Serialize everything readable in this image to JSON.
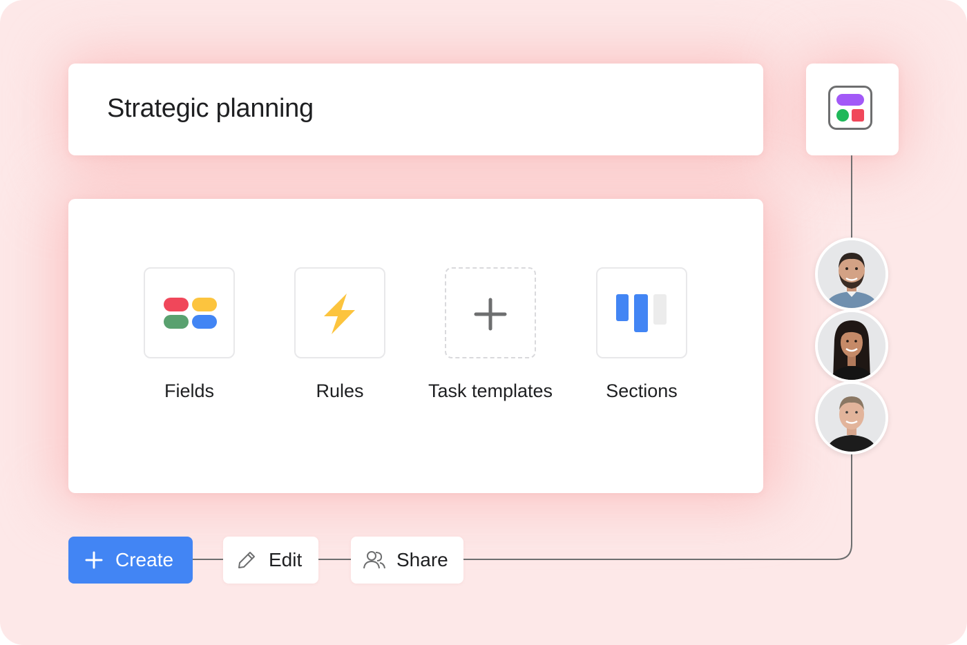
{
  "project": {
    "title": "Strategic planning",
    "logo_icon": "project-grid-icon"
  },
  "features": [
    {
      "label": "Fields",
      "icon": "fields-icon"
    },
    {
      "label": "Rules",
      "icon": "lightning-icon"
    },
    {
      "label": "Task templates",
      "icon": "plus-icon"
    },
    {
      "label": "Sections",
      "icon": "sections-icon"
    }
  ],
  "members": [
    {
      "icon": "avatar-man-beard"
    },
    {
      "icon": "avatar-woman-dark-hair"
    },
    {
      "icon": "avatar-man-short-hair"
    }
  ],
  "actions": {
    "create_label": "Create",
    "edit_label": "Edit",
    "share_label": "Share"
  },
  "colors": {
    "background": "#fde8e8",
    "create_button": "#4285f4",
    "field_red": "#f0475a",
    "field_yellow": "#fcc43e",
    "field_green": "#59a16f",
    "field_blue": "#4285f4",
    "rules_bolt": "#fcc43e",
    "logo_purple": "#a259f7",
    "logo_green": "#1fb85a",
    "logo_red": "#f0475a"
  }
}
